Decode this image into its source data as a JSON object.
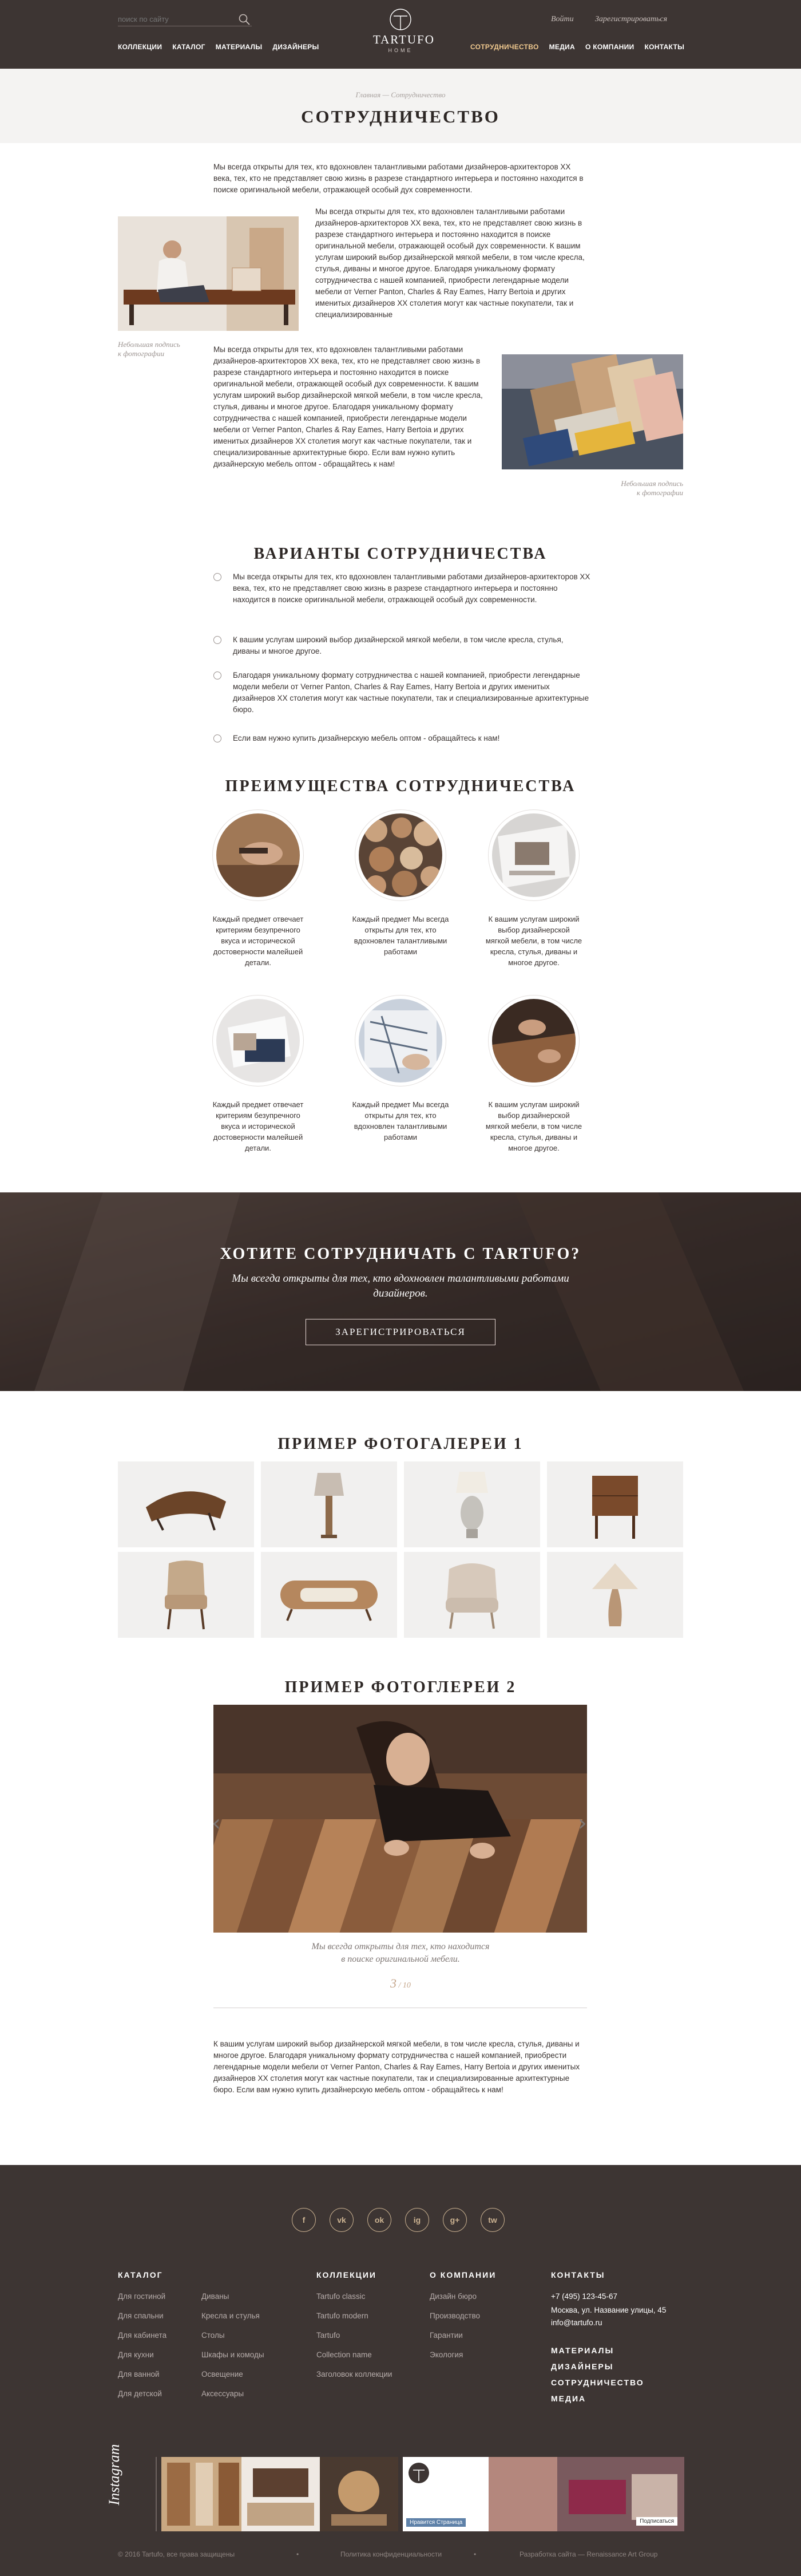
{
  "header": {
    "search_placeholder": "поиск по сайту",
    "login": "Войти",
    "register": "Зарегистрироваться",
    "nav_left": [
      "КОЛЛЕКЦИИ",
      "КАТАЛОГ",
      "МАТЕРИАЛЫ",
      "ДИЗАЙНЕРЫ"
    ],
    "nav_right": [
      "СОТРУДНИЧЕСТВО",
      "МЕДИА",
      "О КОМПАНИИ",
      "КОНТАКТЫ"
    ],
    "logo_word": "TARTUFO",
    "logo_sub": "HOME"
  },
  "page": {
    "breadcrumb_1": "Главная",
    "breadcrumb_sep": " — ",
    "breadcrumb_2": "Сотрудничество",
    "title": "СОТРУДНИЧЕСТВО"
  },
  "intro": {
    "p1": "Мы всегда открыты для тех, кто вдохновлен талантливыми работами дизайнеров-архитекторов XX века, тех, кто не представляет свою жизнь в разрезе стандартного интерьера и постоянно находится в поиске оригинальной мебели, отражающей особый дух современности.",
    "p2": "Мы всегда открыты для тех, кто вдохновлен талантливыми работами дизайнеров-архитекторов XX века, тех, кто не представляет свою жизнь в разрезе стандартного интерьера и постоянно находится в поиске оригинальной мебели, отражающей особый дух современности. К вашим услугам широкий выбор дизайнерской мягкой мебели, в том числе кресла, стулья, диваны и многое другое. Благодаря уникальному формату сотрудничества с нашей компанией, приобрести легендарные модели мебели от Verner Panton, Charles & Ray Eames, Harry Bertoia и других именитых дизайнеров XX столетия могут как частные покупатели, так и специализированные",
    "p3": "Мы всегда открыты для тех, кто вдохновлен талантливыми работами дизайнеров-архитекторов XX века, тех, кто не представляет свою жизнь в разрезе стандартного интерьера и постоянно находится в поиске оригинальной мебели, отражающей особый дух современности. К вашим услугам широкий выбор дизайнерской мягкой мебели, в том числе кресла, стулья, диваны и многое другое. Благодаря уникальному формату сотрудничества с нашей компанией, приобрести легендарные модели мебели от Verner Panton, Charles & Ray Eames, Harry Bertoia и других именитых дизайнеров XX столетия могут как частные покупатели, так и специализированные архитектурные бюро. Если вам нужно купить дизайнерскую мебель оптом - обращайтесь к нам!",
    "caption_1": "Небольшая подпись\nк фотографии",
    "caption_2": "Небольшая подпись\nк фотографии"
  },
  "variants": {
    "title": "ВАРИАНТЫ СОТРУДНИЧЕСТВА",
    "items": [
      "Мы всегда открыты для тех, кто вдохновлен талантливыми работами дизайнеров-архитекторов XX века, тех, кто не представляет свою жизнь в разрезе стандартного интерьера и постоянно находится в поиске оригинальной мебели, отражающей особый дух современности.",
      "К вашим услугам широкий выбор дизайнерской мягкой мебели, в том числе кресла, стулья, диваны и многое другое.",
      "Благодаря уникальному формату сотрудничества с нашей компанией, приобрести легендарные модели мебели от Verner Panton, Charles & Ray Eames, Harry Bertoia и других именитых дизайнеров XX столетия могут как частные покупатели, так и специализированные архитектурные бюро.",
      "Если вам нужно купить дизайнерскую мебель оптом - обращайтесь к нам!"
    ]
  },
  "advantages": {
    "title": "ПРЕИМУЩЕСТВА СОТРУДНИЧЕСТВА",
    "items": [
      "Каждый предмет отвечает критериям безупречного вкуса и исторической достоверности малейшей детали.",
      "Каждый предмет Мы всегда открыты для тех, кто вдохновлен талантливыми работами",
      "К вашим услугам широкий выбор дизайнерской мягкой мебели, в том числе кресла, стулья, диваны и многое другое.",
      "Каждый предмет отвечает критериям безупречного вкуса и исторической достоверности малейшей детали.",
      "Каждый предмет Мы всегда открыты для тех, кто вдохновлен талантливыми работами",
      "К вашим услугам широкий выбор дизайнерской мягкой мебели, в том числе кресла, стулья, диваны и многое другое."
    ]
  },
  "cta": {
    "title": "ХОТИТЕ СОТРУДНИЧАТЬ С TARTUFO?",
    "subtitle": "Мы всегда открыты для тех, кто вдохновлен талантливыми работами дизайнеров.",
    "button": "ЗАРЕГИСТРИРОВАТЬСЯ"
  },
  "gallery1": {
    "title": "ПРИМЕР ФОТОГАЛЕРЕИ 1"
  },
  "gallery2": {
    "title": "ПРИМЕР ФОТОГЛЕРЕИ 2",
    "caption": "Мы всегда открыты для тех, кто находится\nв поиске оригинальной мебели.",
    "current": "3",
    "total": "/ 10",
    "text": "К вашим услугам широкий выбор дизайнерской мягкой мебели, в том числе кресла, стулья, диваны и многое другое. Благодаря уникальному формату сотрудничества с нашей компанией, приобрести легендарные модели мебели от Verner Panton, Charles & Ray Eames, Harry Bertoia и других именитых дизайнеров XX столетия могут как частные покупатели, так и специализированные архитектурные бюро. Если вам нужно купить дизайнерскую мебель оптом - обращайтесь к нам!"
  },
  "footer": {
    "social": [
      "f",
      "vk",
      "ok",
      "ig",
      "g+",
      "tw"
    ],
    "catalog_title": "КАТАЛОГ",
    "catalog_col1": [
      "Для гостиной",
      "Для спальни",
      "Для кабинета",
      "Для кухни",
      "Для ванной",
      "Для детской"
    ],
    "catalog_col2": [
      "Диваны",
      "Кресла и стулья",
      "Столы",
      "Шкафы и комоды",
      "Освещение",
      "Аксессуары"
    ],
    "collections_title": "КОЛЛЕКЦИИ",
    "collections": [
      "Tartufo classic",
      "Tartufo modern",
      "Tartufo",
      "Collection name",
      "Заголовок коллекции"
    ],
    "company_title": "О КОМПАНИИ",
    "company": [
      "Дизайн бюро",
      "Производство",
      "Гарантии",
      "Экология"
    ],
    "contacts_title": "КОНТАКТЫ",
    "phone": "+7 (495) 123-45-67",
    "address": "Москва, ул. Название улицы, 45",
    "email": "info@tartufo.ru",
    "big_links": [
      "МАТЕРИАЛЫ",
      "ДИЗАЙНЕРЫ",
      "СОТРУДНИЧЕСТВО",
      "МЕДИА"
    ],
    "instagram": "Instagram",
    "vk_like": "Нравится Страница",
    "fb_sub": "Подписаться",
    "copyright": "© 2016 Tartufo, все права защищены",
    "policy": "Политика конфиденциальности",
    "dev": "Разработка сайта — Renaissance Art Group",
    "dot": "•"
  },
  "colors": {
    "header_bg": "#3d3533",
    "accent": "#f0c98f",
    "gold": "#cbb291"
  }
}
